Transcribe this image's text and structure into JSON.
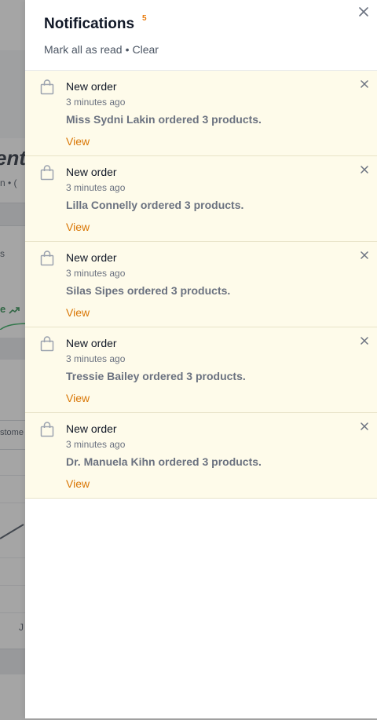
{
  "background": {
    "heading_fragment": "ent",
    "subtitle_fragment": "n • (",
    "stat_fragment": "s",
    "trend_fragment": "e",
    "table_column_fragment": "stome",
    "axis_tick_fragment": "J"
  },
  "drawer": {
    "title": "Notifications",
    "badge_count": "5",
    "mark_all_label": "Mark all as read",
    "separator": "•",
    "clear_label": "Clear",
    "close_icon": "close-icon"
  },
  "notifications": [
    {
      "icon": "shopping-bag-icon",
      "title": "New order",
      "time": "3 minutes ago",
      "message": "Miss Sydni Lakin ordered 3 products.",
      "action_label": "View"
    },
    {
      "icon": "shopping-bag-icon",
      "title": "New order",
      "time": "3 minutes ago",
      "message": "Lilla Connelly ordered 3 products.",
      "action_label": "View"
    },
    {
      "icon": "shopping-bag-icon",
      "title": "New order",
      "time": "3 minutes ago",
      "message": "Silas Sipes ordered 3 products.",
      "action_label": "View"
    },
    {
      "icon": "shopping-bag-icon",
      "title": "New order",
      "time": "3 minutes ago",
      "message": "Tressie Bailey ordered 3 products.",
      "action_label": "View"
    },
    {
      "icon": "shopping-bag-icon",
      "title": "New order",
      "time": "3 minutes ago",
      "message": "Dr. Manuela Kihn ordered 3 products.",
      "action_label": "View"
    }
  ],
  "colors": {
    "accent_link": "#d97706",
    "badge": "#e97b0c",
    "unread_bg": "#fefbea",
    "trend_up": "#15803d"
  }
}
